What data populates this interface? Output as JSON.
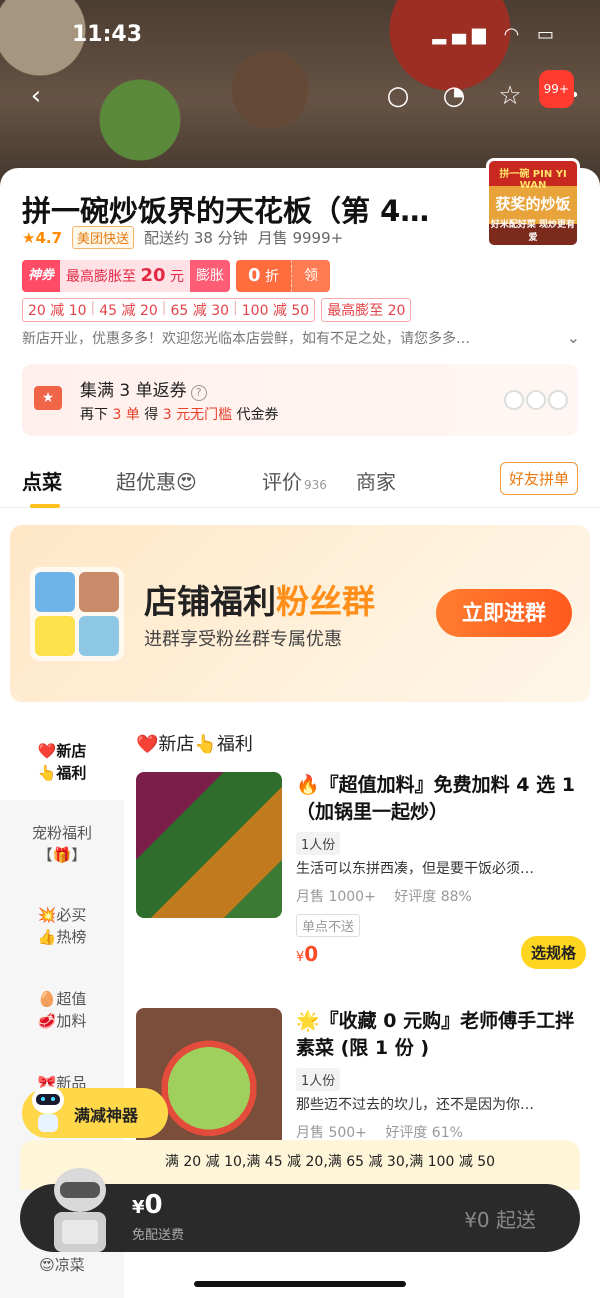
{
  "status": {
    "time": "11:43",
    "icons": "▂▄▆ ◠ ▭"
  },
  "nav": {
    "back_icon": "‹",
    "search_icon": "○",
    "service_icon": "◔",
    "favorite_icon": "☆",
    "more_icon": "•••",
    "more_badge": "99+"
  },
  "shop": {
    "title": "拼一碗炒饭界的天花板（第 4…",
    "logo_top": "拼一碗 PIN YI WAN",
    "logo_main": "获奖的炒饭",
    "logo_foot": "好米配好菜 现炒更有爱",
    "rating": "★4.7",
    "delivery_tag": "美团快送",
    "delivery_time": "配送约 38 分钟",
    "monthly_sales": "月售 9999+",
    "shenquan": {
      "tag": "神券",
      "text_prefix": "最高膨胀至",
      "amount": "20",
      "text_suffix": "元",
      "action": "膨胀"
    },
    "zhe": {
      "amount": "0",
      "unit": "折",
      "action": "领"
    },
    "coupons": [
      "20 减 10",
      "45 减 20",
      "65 减 30",
      "100 减 50"
    ],
    "max_boost": "最高膨至 20",
    "notice": "新店开业，优惠多多！欢迎您光临本店尝鲜，如有不足之处，请您多多…",
    "notice_chevron": "⌄",
    "collect": {
      "title": "集满 3 单返券",
      "q": "?",
      "sub_prefix": "再下",
      "sub_count": "3 单",
      "sub_mid": "得",
      "sub_value": "3 元无门槛",
      "sub_suffix": "代金券",
      "icon": "★"
    }
  },
  "tabs": {
    "order": "点菜",
    "super": "超优惠😍",
    "review": "评价",
    "review_count": "936",
    "merchant": "商家",
    "friend_btn": "好友拼单"
  },
  "banner": {
    "title_a": "店铺福利",
    "title_b": "粉丝群",
    "sub": "进群享受粉丝群专属优惠",
    "btn": "立即进群",
    "avatar_colors": [
      "#6fb4e9",
      "#c98b6a",
      "#ffe14d",
      "#8ec6e6"
    ]
  },
  "side": {
    "items": [
      {
        "line1": "❤️新店",
        "line2": "👆福利"
      },
      {
        "line1": "宠粉福利",
        "line2": "【🎁】"
      },
      {
        "line1": "💥必买",
        "line2": "👍热榜"
      },
      {
        "line1": "🥚超值",
        "line2": "🥩加料"
      },
      {
        "line1": "🎀新品",
        "line2": ""
      },
      {
        "line1": "😍凉菜",
        "line2": ""
      }
    ]
  },
  "section_title": "❤️新店👆福利",
  "products": [
    {
      "name": "🔥『超值加料』免费加料 4 选 1（加锅里一起炒）",
      "portion": "1人份",
      "desc": "生活可以东拼西凑，但是要干饭必须…",
      "sales": "月售 1000+",
      "rating": "好评度 88%",
      "noship": "单点不送",
      "currency": "¥",
      "price": "0",
      "spec_btn": "选规格"
    },
    {
      "name": "🌟『收藏 0 元购』老师傅手工拌素菜 (限 1 份 )",
      "portion": "1人份",
      "desc": "那些迈不过去的坎儿，还不是因为你…",
      "sales": "月售 500+",
      "rating": "好评度 61%"
    }
  ],
  "robot_pill": {
    "label": "满减神器"
  },
  "discount_strip": "满 20 减 10,满 45 减 20,满 65 减 30,满 100 减 50",
  "cart": {
    "currency": "¥",
    "price": "0",
    "fee": "免配送费",
    "min": "¥0 起送"
  },
  "colors": {
    "accent": "#ffd61f",
    "price": "#ff4a26",
    "brand_orange": "#ff7c2f"
  }
}
